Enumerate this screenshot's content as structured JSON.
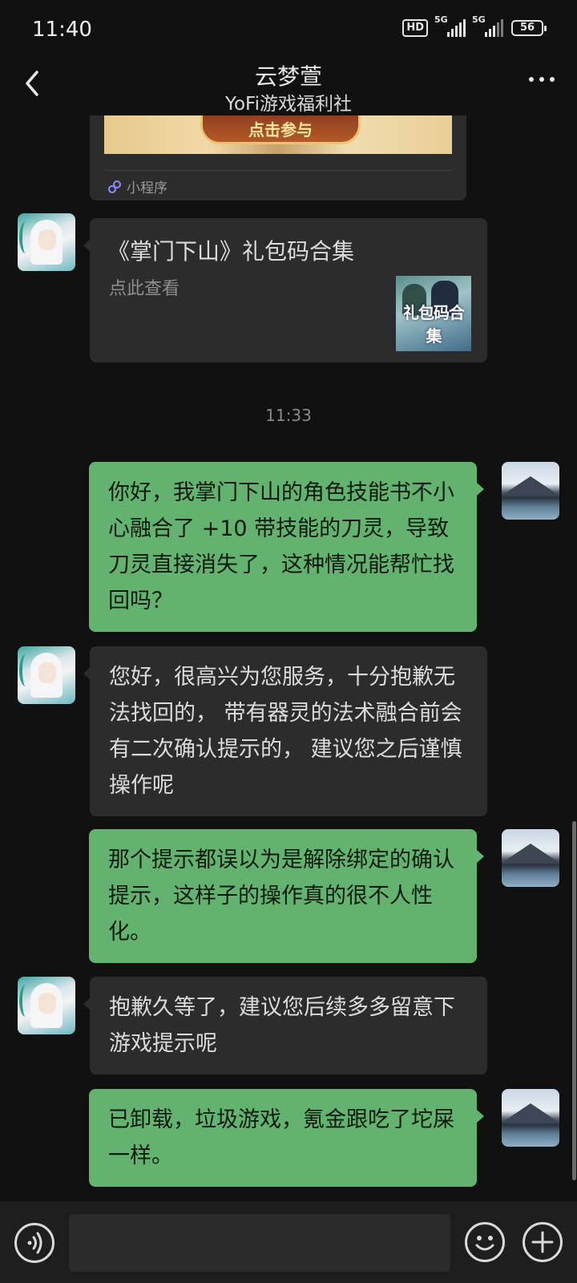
{
  "status_bar": {
    "time": "11:40",
    "hd_label": "HD",
    "network_1": "5G",
    "network_2": "5G",
    "battery": "56"
  },
  "header": {
    "title": "云梦萱",
    "subtitle": "YoFi游戏福利社",
    "back_icon": "chevron-left-icon",
    "more_icon": "more-dots-icon"
  },
  "mini_program_card": {
    "thumb_button_text": "点击参与",
    "label": "小程序",
    "icon": "mini-program-icon"
  },
  "link_card": {
    "title": "《掌门下山》礼包码合集",
    "description": "点此查看",
    "thumb_text": "礼包码合集"
  },
  "timestamp": "11:33",
  "messages": [
    {
      "from": "me",
      "text": "你好，我掌门下山的角色技能书不小心融合了 +10 带技能的刀灵，导致刀灵直接消失了，这种情况能帮忙找回吗？"
    },
    {
      "from": "them",
      "text": "您好，很高兴为您服务，十分抱歉无法找回的， 带有器灵的法术融合前会有二次确认提示的， 建议您之后谨慎操作呢"
    },
    {
      "from": "me",
      "text": "那个提示都误以为是解除绑定的确认提示，这样子的操作真的很不人性化。"
    },
    {
      "from": "them",
      "text": "抱歉久等了，建议您后续多多留意下游戏提示呢"
    },
    {
      "from": "me",
      "text": "已卸载，垃圾游戏，氪金跟吃了坨屎一样。"
    }
  ],
  "input_bar": {
    "placeholder": "",
    "voice_icon": "voice-icon",
    "emoji_icon": "emoji-icon",
    "plus_icon": "plus-icon"
  },
  "colors": {
    "background": "#111111",
    "incoming_bubble": "#2c2c2c",
    "outgoing_bubble": "#63b26f"
  }
}
